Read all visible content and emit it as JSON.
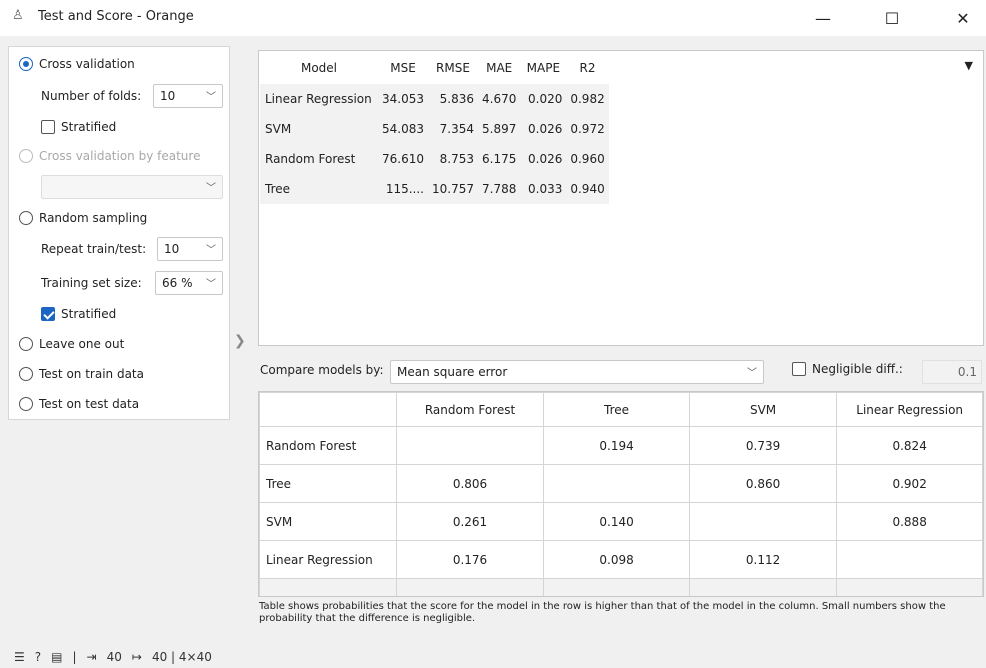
{
  "window": {
    "title": "Test and Score - Orange",
    "minimize": "—",
    "maximize": "☐",
    "close": "✕"
  },
  "sampling": {
    "cross_validation": "Cross validation",
    "number_of_folds_label": "Number of folds:",
    "number_of_folds_value": "10",
    "stratified_cv": "Stratified",
    "cv_by_feature": "Cross validation by feature",
    "random_sampling": "Random sampling",
    "repeat_label": "Repeat train/test:",
    "repeat_value": "10",
    "training_size_label": "Training set size:",
    "training_size_value": "66 %",
    "stratified_rs": "Stratified",
    "leave_one_out": "Leave one out",
    "test_on_train": "Test on train data",
    "test_on_test": "Test on test data"
  },
  "evaluation": {
    "headers": [
      "Model",
      "MSE",
      "RMSE",
      "MAE",
      "MAPE",
      "R2"
    ],
    "rows": [
      [
        "Linear Regression",
        "34.053",
        "5.836",
        "4.670",
        "0.020",
        "0.982"
      ],
      [
        "SVM",
        "54.083",
        "7.354",
        "5.897",
        "0.026",
        "0.972"
      ],
      [
        "Random Forest",
        "76.610",
        "8.753",
        "6.175",
        "0.026",
        "0.960"
      ],
      [
        "Tree",
        "115....",
        "10.757",
        "7.788",
        "0.033",
        "0.940"
      ]
    ]
  },
  "compare": {
    "label": "Compare models by:",
    "metric": "Mean square error",
    "negligible_label": "Negligible diff.:",
    "negligible_value": "0.1",
    "columns": [
      "Random Forest",
      "Tree",
      "SVM",
      "Linear Regression"
    ],
    "rows": [
      {
        "name": "Random Forest",
        "cells": [
          "",
          "0.194",
          "0.739",
          "0.824"
        ]
      },
      {
        "name": "Tree",
        "cells": [
          "0.806",
          "",
          "0.860",
          "0.902"
        ]
      },
      {
        "name": "SVM",
        "cells": [
          "0.261",
          "0.140",
          "",
          "0.888"
        ]
      },
      {
        "name": "Linear Regression",
        "cells": [
          "0.176",
          "0.098",
          "0.112",
          ""
        ]
      }
    ],
    "footnote": "Table shows probabilities that the score for the model in the row is higher than that of the model in the column. Small numbers show the probability that the difference is negligible."
  },
  "status": {
    "input_count": "40",
    "output_summary": "40 | 4×40"
  },
  "colors": {
    "accent": "#1c65c2"
  }
}
